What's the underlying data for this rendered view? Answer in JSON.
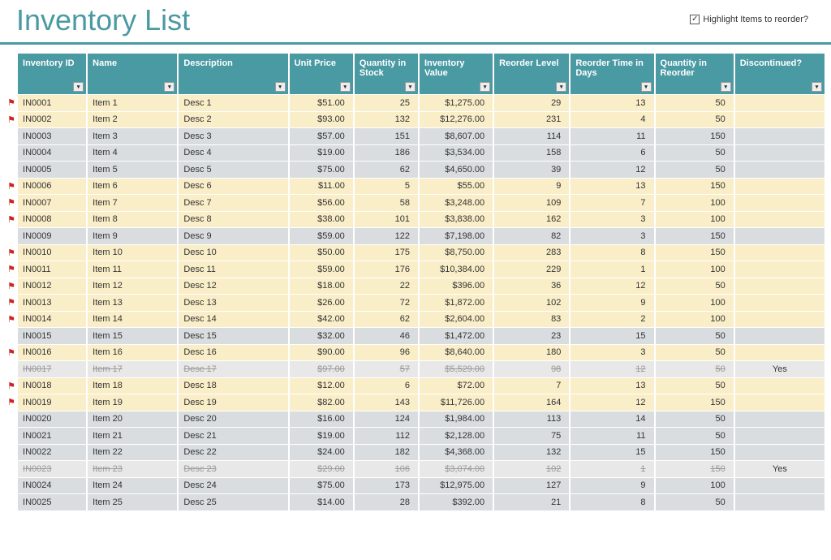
{
  "title": "Inventory List",
  "highlight_label": "Highlight Items to reorder?",
  "highlight_checked": true,
  "columns": [
    {
      "key": "id",
      "label": "Inventory ID",
      "cls": "c-id"
    },
    {
      "key": "name",
      "label": "Name",
      "cls": "c-name"
    },
    {
      "key": "desc",
      "label": "Description",
      "cls": "c-desc"
    },
    {
      "key": "price",
      "label": "Unit Price",
      "cls": "c-price",
      "num": true
    },
    {
      "key": "qty",
      "label": "Quantity in Stock",
      "cls": "c-qty",
      "num": true
    },
    {
      "key": "value",
      "label": "Inventory Value",
      "cls": "c-val",
      "num": true
    },
    {
      "key": "rlvl",
      "label": "Reorder Level",
      "cls": "c-rlvl",
      "num": true
    },
    {
      "key": "rtime",
      "label": "Reorder Time in Days",
      "cls": "c-rtime",
      "num": true
    },
    {
      "key": "rqty",
      "label": "Quantity in Reorder",
      "cls": "c-rqty",
      "num": true
    },
    {
      "key": "disc",
      "label": "Discontinued?",
      "cls": "c-disc"
    }
  ],
  "rows": [
    {
      "flag": true,
      "id": "IN0001",
      "name": "Item 1",
      "desc": "Desc 1",
      "price": "$51.00",
      "qty": "25",
      "value": "$1,275.00",
      "rlvl": "29",
      "rtime": "13",
      "rqty": "50",
      "disc": "",
      "style": "y"
    },
    {
      "flag": true,
      "id": "IN0002",
      "name": "Item 2",
      "desc": "Desc 2",
      "price": "$93.00",
      "qty": "132",
      "value": "$12,276.00",
      "rlvl": "231",
      "rtime": "4",
      "rqty": "50",
      "disc": "",
      "style": "y"
    },
    {
      "flag": false,
      "id": "IN0003",
      "name": "Item 3",
      "desc": "Desc 3",
      "price": "$57.00",
      "qty": "151",
      "value": "$8,607.00",
      "rlvl": "114",
      "rtime": "11",
      "rqty": "150",
      "disc": "",
      "style": "g"
    },
    {
      "flag": false,
      "id": "IN0004",
      "name": "Item 4",
      "desc": "Desc 4",
      "price": "$19.00",
      "qty": "186",
      "value": "$3,534.00",
      "rlvl": "158",
      "rtime": "6",
      "rqty": "50",
      "disc": "",
      "style": "g"
    },
    {
      "flag": false,
      "id": "IN0005",
      "name": "Item 5",
      "desc": "Desc 5",
      "price": "$75.00",
      "qty": "62",
      "value": "$4,650.00",
      "rlvl": "39",
      "rtime": "12",
      "rqty": "50",
      "disc": "",
      "style": "g"
    },
    {
      "flag": true,
      "id": "IN0006",
      "name": "Item 6",
      "desc": "Desc 6",
      "price": "$11.00",
      "qty": "5",
      "value": "$55.00",
      "rlvl": "9",
      "rtime": "13",
      "rqty": "150",
      "disc": "",
      "style": "y"
    },
    {
      "flag": true,
      "id": "IN0007",
      "name": "Item 7",
      "desc": "Desc 7",
      "price": "$56.00",
      "qty": "58",
      "value": "$3,248.00",
      "rlvl": "109",
      "rtime": "7",
      "rqty": "100",
      "disc": "",
      "style": "y"
    },
    {
      "flag": true,
      "id": "IN0008",
      "name": "Item 8",
      "desc": "Desc 8",
      "price": "$38.00",
      "qty": "101",
      "value": "$3,838.00",
      "rlvl": "162",
      "rtime": "3",
      "rqty": "100",
      "disc": "",
      "style": "y"
    },
    {
      "flag": false,
      "id": "IN0009",
      "name": "Item 9",
      "desc": "Desc 9",
      "price": "$59.00",
      "qty": "122",
      "value": "$7,198.00",
      "rlvl": "82",
      "rtime": "3",
      "rqty": "150",
      "disc": "",
      "style": "g"
    },
    {
      "flag": true,
      "id": "IN0010",
      "name": "Item 10",
      "desc": "Desc 10",
      "price": "$50.00",
      "qty": "175",
      "value": "$8,750.00",
      "rlvl": "283",
      "rtime": "8",
      "rqty": "150",
      "disc": "",
      "style": "y"
    },
    {
      "flag": true,
      "id": "IN0011",
      "name": "Item 11",
      "desc": "Desc 11",
      "price": "$59.00",
      "qty": "176",
      "value": "$10,384.00",
      "rlvl": "229",
      "rtime": "1",
      "rqty": "100",
      "disc": "",
      "style": "y"
    },
    {
      "flag": true,
      "id": "IN0012",
      "name": "Item 12",
      "desc": "Desc 12",
      "price": "$18.00",
      "qty": "22",
      "value": "$396.00",
      "rlvl": "36",
      "rtime": "12",
      "rqty": "50",
      "disc": "",
      "style": "y"
    },
    {
      "flag": true,
      "id": "IN0013",
      "name": "Item 13",
      "desc": "Desc 13",
      "price": "$26.00",
      "qty": "72",
      "value": "$1,872.00",
      "rlvl": "102",
      "rtime": "9",
      "rqty": "100",
      "disc": "",
      "style": "y"
    },
    {
      "flag": true,
      "id": "IN0014",
      "name": "Item 14",
      "desc": "Desc 14",
      "price": "$42.00",
      "qty": "62",
      "value": "$2,604.00",
      "rlvl": "83",
      "rtime": "2",
      "rqty": "100",
      "disc": "",
      "style": "y"
    },
    {
      "flag": false,
      "id": "IN0015",
      "name": "Item 15",
      "desc": "Desc 15",
      "price": "$32.00",
      "qty": "46",
      "value": "$1,472.00",
      "rlvl": "23",
      "rtime": "15",
      "rqty": "50",
      "disc": "",
      "style": "g"
    },
    {
      "flag": true,
      "id": "IN0016",
      "name": "Item 16",
      "desc": "Desc 16",
      "price": "$90.00",
      "qty": "96",
      "value": "$8,640.00",
      "rlvl": "180",
      "rtime": "3",
      "rqty": "50",
      "disc": "",
      "style": "y"
    },
    {
      "flag": false,
      "id": "IN0017",
      "name": "Item 17",
      "desc": "Desc 17",
      "price": "$97.00",
      "qty": "57",
      "value": "$5,529.00",
      "rlvl": "98",
      "rtime": "12",
      "rqty": "50",
      "disc": "Yes",
      "style": "d"
    },
    {
      "flag": true,
      "id": "IN0018",
      "name": "Item 18",
      "desc": "Desc 18",
      "price": "$12.00",
      "qty": "6",
      "value": "$72.00",
      "rlvl": "7",
      "rtime": "13",
      "rqty": "50",
      "disc": "",
      "style": "y"
    },
    {
      "flag": true,
      "id": "IN0019",
      "name": "Item 19",
      "desc": "Desc 19",
      "price": "$82.00",
      "qty": "143",
      "value": "$11,726.00",
      "rlvl": "164",
      "rtime": "12",
      "rqty": "150",
      "disc": "",
      "style": "y"
    },
    {
      "flag": false,
      "id": "IN0020",
      "name": "Item 20",
      "desc": "Desc 20",
      "price": "$16.00",
      "qty": "124",
      "value": "$1,984.00",
      "rlvl": "113",
      "rtime": "14",
      "rqty": "50",
      "disc": "",
      "style": "g"
    },
    {
      "flag": false,
      "id": "IN0021",
      "name": "Item 21",
      "desc": "Desc 21",
      "price": "$19.00",
      "qty": "112",
      "value": "$2,128.00",
      "rlvl": "75",
      "rtime": "11",
      "rqty": "50",
      "disc": "",
      "style": "g"
    },
    {
      "flag": false,
      "id": "IN0022",
      "name": "Item 22",
      "desc": "Desc 22",
      "price": "$24.00",
      "qty": "182",
      "value": "$4,368.00",
      "rlvl": "132",
      "rtime": "15",
      "rqty": "150",
      "disc": "",
      "style": "g"
    },
    {
      "flag": false,
      "id": "IN0023",
      "name": "Item 23",
      "desc": "Desc 23",
      "price": "$29.00",
      "qty": "106",
      "value": "$3,074.00",
      "rlvl": "102",
      "rtime": "1",
      "rqty": "150",
      "disc": "Yes",
      "style": "d"
    },
    {
      "flag": false,
      "id": "IN0024",
      "name": "Item 24",
      "desc": "Desc 24",
      "price": "$75.00",
      "qty": "173",
      "value": "$12,975.00",
      "rlvl": "127",
      "rtime": "9",
      "rqty": "100",
      "disc": "",
      "style": "g"
    },
    {
      "flag": false,
      "id": "IN0025",
      "name": "Item 25",
      "desc": "Desc 25",
      "price": "$14.00",
      "qty": "28",
      "value": "$392.00",
      "rlvl": "21",
      "rtime": "8",
      "rqty": "50",
      "disc": "",
      "style": "g"
    }
  ]
}
